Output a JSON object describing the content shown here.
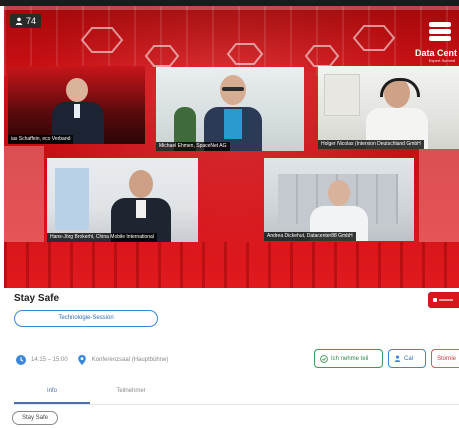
{
  "stage": {
    "viewer_count": "74",
    "brand": {
      "name": "Data Cent",
      "tagline": "Expert Summit"
    }
  },
  "participants": [
    {
      "caption": "ias Schaffein, eco Verband"
    },
    {
      "caption": "Michael Ehmen, SpaceNet AG"
    },
    {
      "caption": "Holger Nicolas (Interxion Deutschland GmbH"
    },
    {
      "caption": "Hans-Jörg Brokerhl, China Mobile International"
    },
    {
      "caption": "Andrea Dickehut, Datacenter88 GmbH"
    }
  ],
  "session": {
    "title": "Stay Safe",
    "track_label": "Technologie-Session",
    "time": "14:15 – 15:00",
    "location": "Konferenzsaal (Hauptbühne)"
  },
  "actions": {
    "attend_label": "Ich nehme teil",
    "calendar_label": "Cal",
    "cancel_label": "Stornie"
  },
  "tabs": [
    {
      "label": "Info"
    },
    {
      "label": "Teilnehmer"
    }
  ],
  "tags": [
    "Stay Safe"
  ],
  "colors": {
    "brand_red": "#d9161c",
    "accent_blue": "#3a86d9",
    "attend_green": "#3b9b57"
  }
}
